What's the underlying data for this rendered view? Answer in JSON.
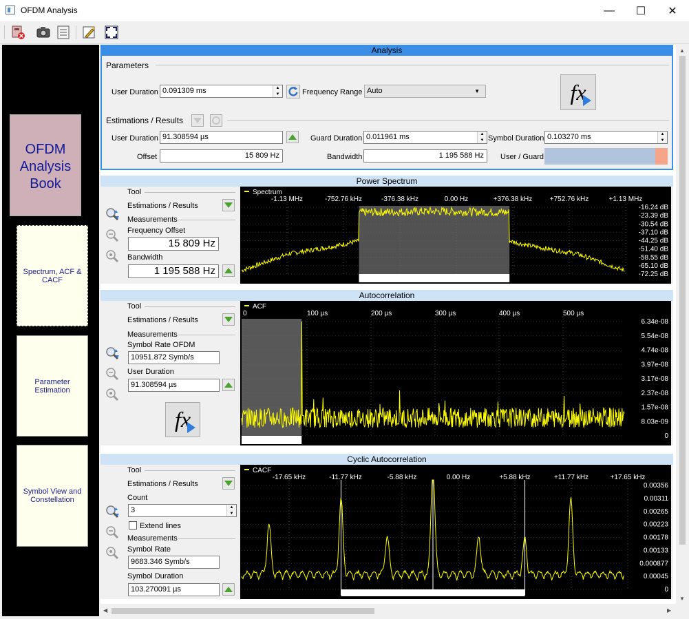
{
  "window": {
    "title": "OFDM Analysis",
    "minimize": "—",
    "maximize": "☐",
    "close": "✕"
  },
  "toolbar": {
    "icons": [
      "close-document-icon",
      "camera-icon",
      "list-icon",
      "edit-icon",
      "fullscreen-icon"
    ]
  },
  "sidebar": {
    "book_title": "OFDM Analysis Book",
    "pages": [
      "Spectrum, ACF & CACF",
      "Parameter Estimation",
      "Symbol View and Constellation"
    ]
  },
  "analysis": {
    "title": "Analysis",
    "parameters_header": "Parameters",
    "user_duration_label": "User Duration",
    "user_duration_value": "0.091309 ms",
    "frequency_range_label": "Frequency Range",
    "frequency_range_value": "Auto",
    "estimations_header": "Estimations / Results",
    "est_user_duration_label": "User Duration",
    "est_user_duration_value": "91.308594 µs",
    "guard_duration_label": "Guard Duration",
    "guard_duration_value": "0.011961 ms",
    "symbol_duration_label": "Symbol Duration",
    "symbol_duration_value": "0.103270 ms",
    "offset_label": "Offset",
    "offset_value": "15 809 Hz",
    "bandwidth_label": "Bandwidth",
    "bandwidth_value": "1 195 588 Hz",
    "user_guard_label": "User / Guard",
    "user_guard_ratio": 0.9,
    "fx_label": "fx"
  },
  "power_spectrum": {
    "title": "Power Spectrum",
    "tool": "Tool",
    "estimations": "Estimations / Results",
    "measurements": "Measurements",
    "freq_offset_label": "Frequency Offset",
    "freq_offset_value": "15 809 Hz",
    "bandwidth_label": "Bandwidth",
    "bandwidth_value": "1 195 588 Hz"
  },
  "autocorrelation": {
    "title": "Autocorrelation",
    "tool": "Tool",
    "estimations": "Estimations / Results",
    "measurements": "Measurements",
    "symbol_rate_label": "Symbol Rate OFDM",
    "symbol_rate_value": "10951.872 Symb/s",
    "user_duration_label": "User Duration",
    "user_duration_value": "91.308594 µs",
    "fx_label": "fx"
  },
  "cacf": {
    "title": "Cyclic Autocorrelation",
    "tool": "Tool",
    "estimations": "Estimations / Results",
    "count_label": "Count",
    "count_value": "3",
    "extend_lines": "Extend lines",
    "measurements": "Measurements",
    "symbol_rate_label": "Symbol Rate",
    "symbol_rate_value": "9683.346 Symb/s",
    "symbol_duration_label": "Symbol Duration",
    "symbol_duration_value": "103.270091 µs"
  },
  "chart_data": [
    {
      "type": "area",
      "legend": "Spectrum",
      "x_ticks": [
        "-1.13 MHz",
        "-752.76 kHz",
        "-376.38 kHz",
        "0.00 Hz",
        "+376.38 kHz",
        "+752.76 kHz",
        "+1.13 MHz"
      ],
      "y_ticks": [
        "-16.24 dB",
        "-23.39 dB",
        "-30.54 dB",
        "-37.10 dB",
        "-44.25 dB",
        "-51.40 dB",
        "-58.55 dB",
        "-65.10 dB",
        "-72.25 dB"
      ],
      "x": [
        -1.5,
        -1.13,
        -0.75,
        -0.58,
        -0.58,
        0,
        0.6,
        0.6,
        0.75,
        1.13,
        1.5
      ],
      "y": [
        -72,
        -58,
        -51,
        -47,
        -23,
        -22,
        -23,
        -47,
        -51,
        -58,
        -72
      ],
      "series_color": "#ffff00"
    },
    {
      "type": "line",
      "legend": "ACF",
      "x_ticks": [
        "0",
        "100 µs",
        "200 µs",
        "300 µs",
        "400 µs",
        "500 µs"
      ],
      "y_ticks": [
        "6.34e-08",
        "5.54e-08",
        "4.74e-08",
        "3.97e-08",
        "3.17e-08",
        "2.37e-08",
        "1.57e-08",
        "8.03e-09",
        "0"
      ],
      "x": [
        0,
        20,
        40,
        60,
        80,
        90,
        91,
        92,
        100,
        200,
        300,
        400,
        500,
        580
      ],
      "y": [
        1e-08,
        1.2e-08,
        1e-08,
        1.3e-08,
        1.2e-08,
        1.6e-08,
        6.3e-08,
        1.2e-08,
        1e-08,
        1.1e-08,
        1e-08,
        1.1e-08,
        1e-08,
        1e-08
      ],
      "series_color": "#ffff00"
    },
    {
      "type": "line",
      "legend": "CACF",
      "x_ticks": [
        "-17.65 kHz",
        "-11.77 kHz",
        "-5.88 kHz",
        "0.00 Hz",
        "+5.88 kHz",
        "+11.77 kHz",
        "+17.65 kHz"
      ],
      "y_ticks": [
        "0.00356",
        "0.00311",
        "0.00265",
        "0.00223",
        "0.00178",
        "0.00133",
        "0.000877",
        "0.00045",
        "0"
      ],
      "x": [
        -24,
        -21,
        -17.65,
        -14,
        -11.77,
        -9,
        -5.88,
        -3,
        0,
        3,
        5.88,
        9,
        11.77,
        14,
        17.65,
        21,
        24
      ],
      "y": [
        0.0005,
        0.0004,
        0.0022,
        0.0004,
        0.0025,
        0.0004,
        0.0013,
        0.0004,
        0.0036,
        0.0004,
        0.0013,
        0.0004,
        0.0012,
        0.0004,
        0.0025,
        0.0004,
        0.0003
      ],
      "series_color": "#ffff00"
    }
  ]
}
